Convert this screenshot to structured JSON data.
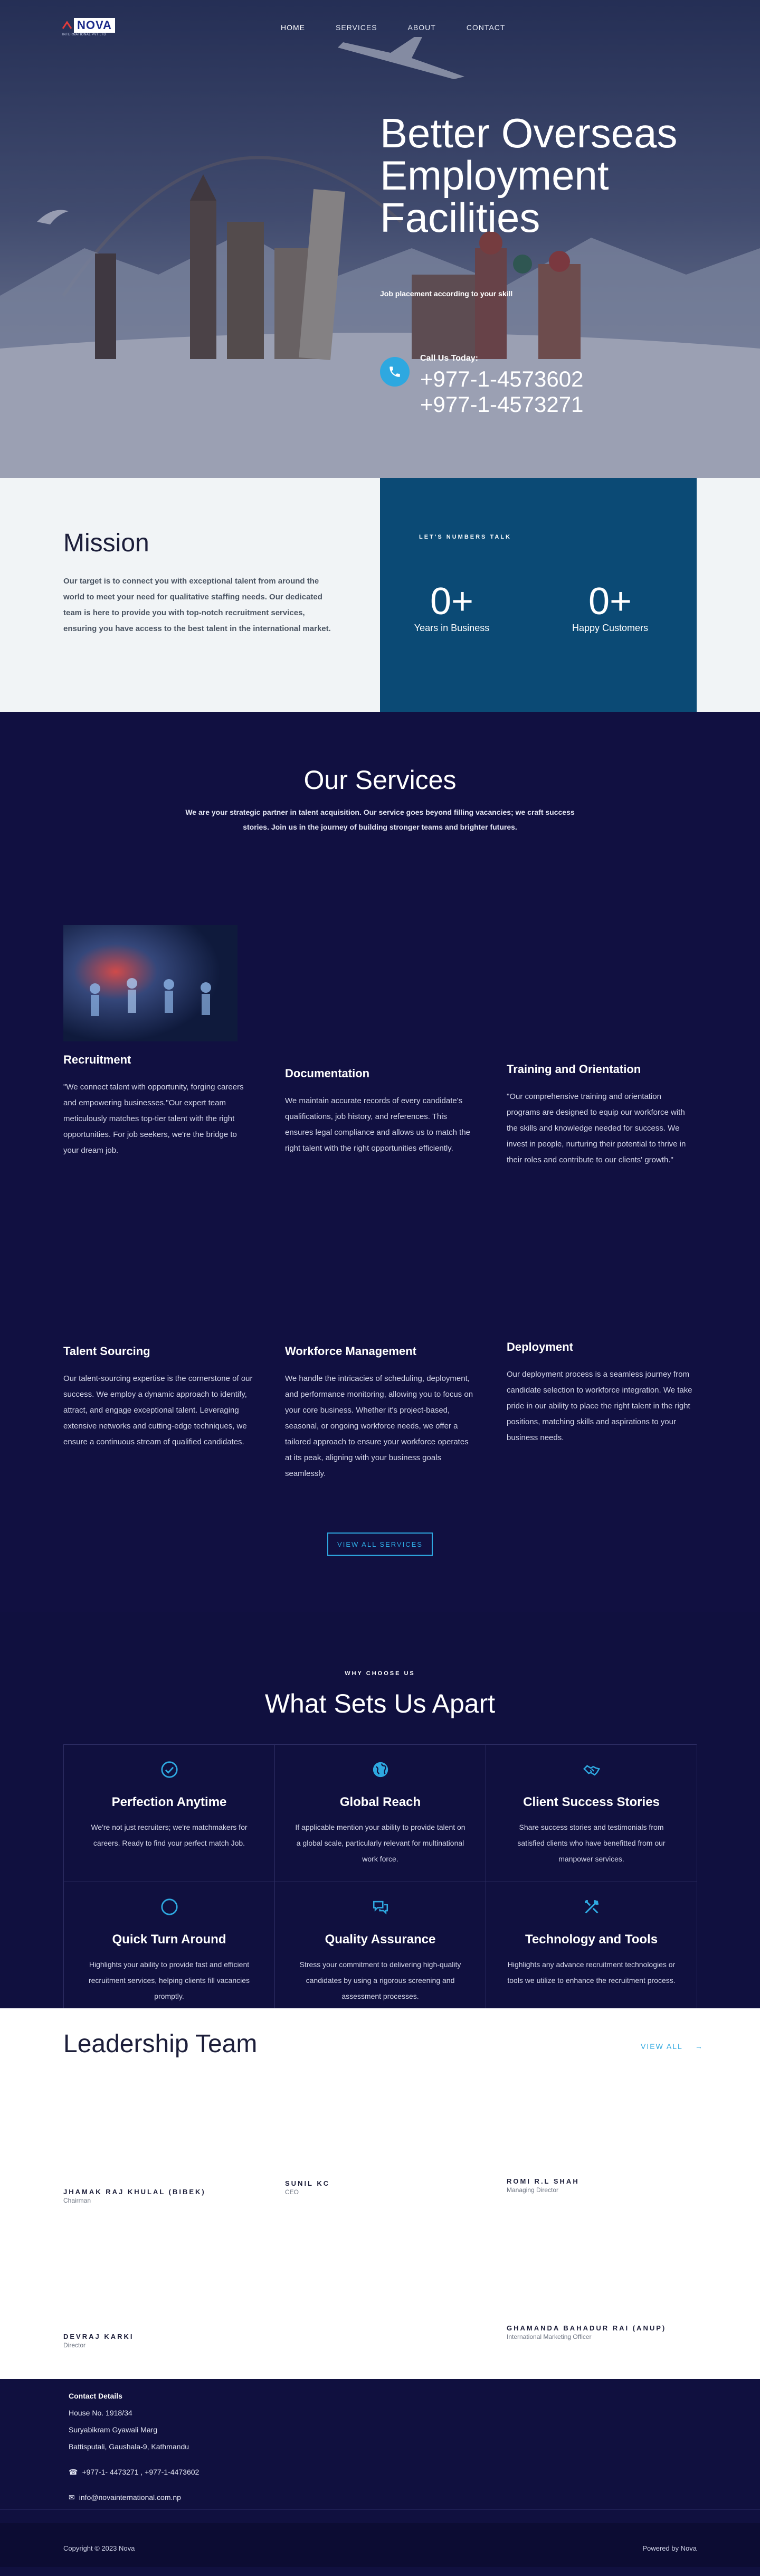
{
  "brand": {
    "logo_text": "NOVA",
    "logo_sub": "INTERNATIONAL PVT.LTD"
  },
  "nav": {
    "items": [
      "HOME",
      "SERVICES",
      "ABOUT",
      "CONTACT"
    ]
  },
  "hero": {
    "title": "Better Overseas Employment Facilities",
    "subtitle": "Job placement according to your skill",
    "call_label": "Call Us Today:",
    "phone1": "+977-1-4573602",
    "phone2": "+977-1-4573271"
  },
  "mission": {
    "title": "Mission",
    "text": "Our target is to connect you with exceptional talent from around the world to meet your need for qualitative staffing needs.   Our dedicated team is here to provide you with top-notch recruitment services, ensuring you have access to the best talent in the international market.",
    "numbers_label": "LET'S NUMBERS TALK",
    "stats": [
      {
        "value": "0+",
        "label": "Years in Business"
      },
      {
        "value": "0+",
        "label": "Happy Customers"
      }
    ]
  },
  "services": {
    "title": "Our Services",
    "intro": "We are your strategic partner in talent acquisition. Our service goes beyond filling vacancies; we craft success stories. Join us in the journey of building stronger teams and brighter futures.",
    "items": [
      {
        "name": "Recruitment",
        "desc": "\"We connect talent with opportunity, forging careers and empowering businesses.\"Our expert team meticulously matches top-tier talent with the right opportunities. For job seekers, we're the bridge to your dream job."
      },
      {
        "name": "Documentation",
        "desc": "We maintain accurate records of every candidate's qualifications, job history, and references. This ensures legal compliance and allows us to match the right talent with the right opportunities efficiently."
      },
      {
        "name": "Training and Orientation",
        "desc": "\"Our comprehensive training and orientation programs are designed to equip our workforce with the skills and knowledge needed for success. We invest in people, nurturing their potential to thrive in their roles and contribute to our clients' growth.\""
      },
      {
        "name": "Talent Sourcing",
        "desc": "Our talent-sourcing expertise is the cornerstone of our success. We employ a dynamic approach to identify, attract, and engage exceptional talent. Leveraging extensive networks and cutting-edge techniques, we ensure a continuous stream of qualified candidates."
      },
      {
        "name": "Workforce Management",
        "desc": "We handle the intricacies of scheduling, deployment, and performance monitoring, allowing you to focus on your core business. Whether it's project-based, seasonal, or ongoing workforce needs, we offer a tailored approach to ensure your workforce operates at its peak, aligning with your business goals seamlessly."
      },
      {
        "name": "Deployment",
        "desc": "Our deployment process is a seamless journey from candidate selection to workforce integration. We take pride in our ability to place the right talent in the right positions, matching skills and aspirations to your business needs."
      }
    ],
    "view_all": "VIEW ALL SERVICES"
  },
  "apart": {
    "kicker": "WHY CHOOSE US",
    "title": "What Sets Us Apart",
    "items": [
      {
        "icon": "check-circle-icon",
        "title": "Perfection Anytime",
        "desc": "We're not just recruiters; we're matchmakers for careers. Ready to find your perfect match Job."
      },
      {
        "icon": "globe-icon",
        "title": "Global Reach",
        "desc": "If applicable mention your ability to provide talent on a global scale, particularly relevant for multinational work force."
      },
      {
        "icon": "handshake-icon",
        "title": "Client Success Stories",
        "desc": "Share success stories and testimonials from satisfied clients who have benefitted from our manpower services."
      },
      {
        "icon": "circle-icon",
        "title": "Quick Turn Around",
        "desc": "Highlights your ability to provide fast and efficient recruitment services, helping clients fill vacancies promptly."
      },
      {
        "icon": "chat-icon",
        "title": "Quality Assurance",
        "desc": "Stress your commitment to delivering high-quality candidates by using a rigorous screening and assessment processes."
      },
      {
        "icon": "tools-icon",
        "title": "Technology and Tools",
        "desc": "Highlights any advance recruitment technologies or tools we utilize to enhance the recruitment process."
      }
    ]
  },
  "leaders": {
    "title": "Leadership Team",
    "view_all": "VIEW ALL",
    "members": [
      {
        "name": "JHAMAK RAJ KHULAL (BIBEK)",
        "role": "Chairman"
      },
      {
        "name": "SUNIL KC",
        "role": "CEO"
      },
      {
        "name": "ROMI R.L SHAH",
        "role": "Managing Director"
      },
      {
        "name": "DEVRAJ KARKI",
        "role": "Director"
      },
      {
        "name": "GHAMANDA BAHADUR RAI (ANUP)",
        "role": "International Marketing Officer"
      }
    ]
  },
  "footer": {
    "heading": "Contact Details",
    "house": "House No. 1918/34",
    "street": "Suryabikram Gyawali Marg",
    "area": "Battisputali, Gaushala-9, Kathmandu",
    "phones": "+977-1- 4473271 , +977-1-4473602",
    "email": "info@novainternational.com.np",
    "copyright": "Copyright © 2023 Nova",
    "powered": "Powered by Nova"
  }
}
